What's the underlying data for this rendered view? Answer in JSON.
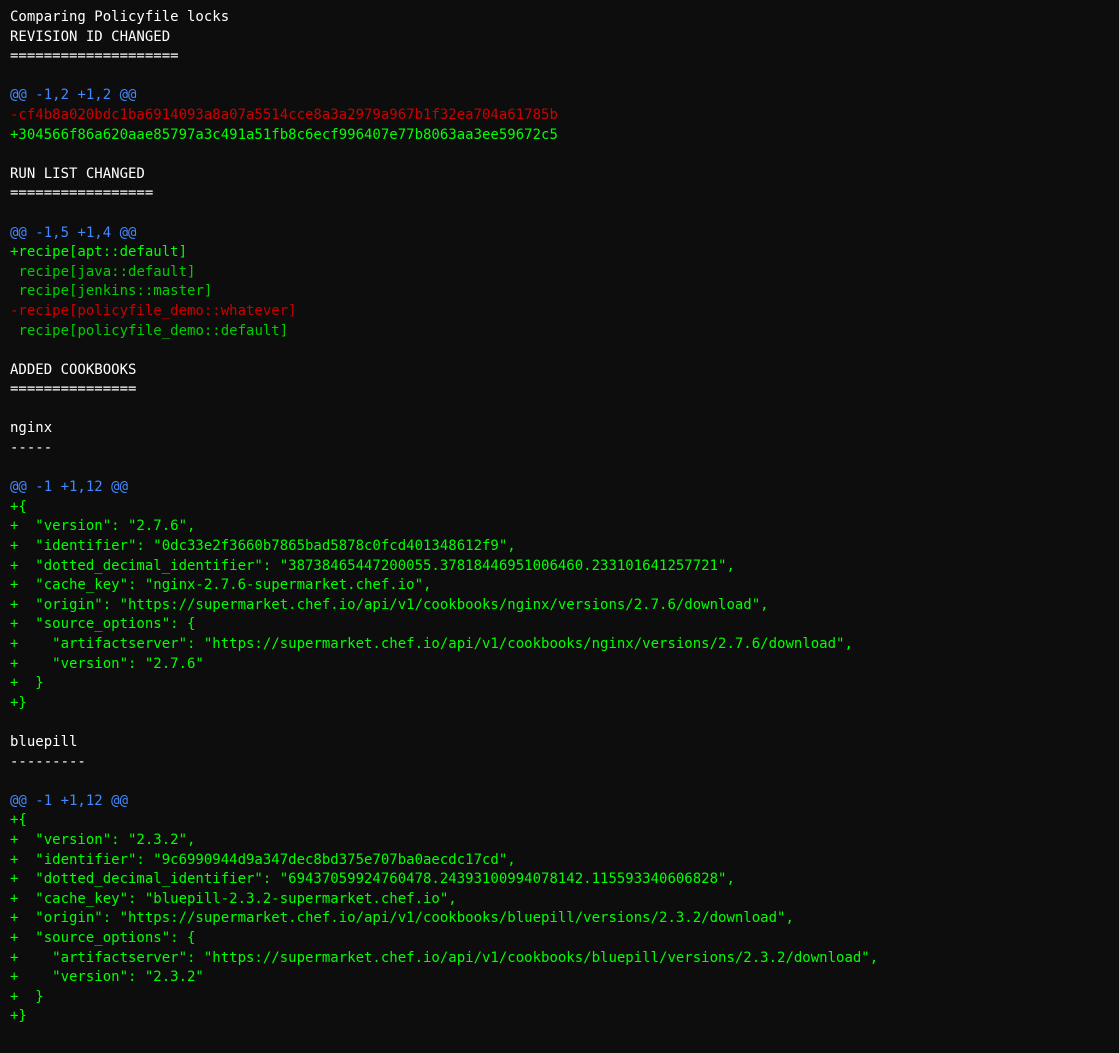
{
  "terminal": {
    "title": "Comparing Policyfile locks",
    "sections": [
      {
        "heading": "REVISION ID CHANGED",
        "separator": "====================",
        "hunk_header": "@@ -1,2 +1,2 @@",
        "lines": [
          {
            "type": "removed",
            "text": "-cf4b8a020bdc1ba6914093a8a07a5514cce8a3a2979a967b1f32ea704a61785b"
          },
          {
            "type": "added",
            "text": "+304566f86a620aae85797a3c491a51fb8c6ecf996407e77b8063aa3ee59672c5"
          }
        ]
      },
      {
        "heading": "RUN LIST CHANGED",
        "separator": "=================",
        "hunk_header": "@@ -1,5 +1,4 @@",
        "lines": [
          {
            "type": "added",
            "text": "+recipe[apt::default]"
          },
          {
            "type": "context",
            "text": " recipe[java::default]"
          },
          {
            "type": "context",
            "text": " recipe[jenkins::master]"
          },
          {
            "type": "removed",
            "text": "-recipe[policyfile_demo::whatever]"
          },
          {
            "type": "context",
            "text": " recipe[policyfile_demo::default]"
          }
        ]
      },
      {
        "heading": "ADDED COOKBOOKS",
        "separator": "===============",
        "cookbooks": [
          {
            "name": "nginx",
            "underline": "-----",
            "hunk_header": "@@ -1 +1,12 @@",
            "lines": [
              "+{",
              "+  \"version\": \"2.7.6\",",
              "+  \"identifier\": \"0dc33e2f3660b7865bad5878c0fcd401348612f9\",",
              "+  \"dotted_decimal_identifier\": \"38738465447200055.37818446951006460.233101641257721\",",
              "+  \"cache_key\": \"nginx-2.7.6-supermarket.chef.io\",",
              "+  \"origin\": \"https://supermarket.chef.io/api/v1/cookbooks/nginx/versions/2.7.6/download\",",
              "+  \"source_options\": {",
              "+    \"artifactserver\": \"https://supermarket.chef.io/api/v1/cookbooks/nginx/versions/2.7.6/download\",",
              "+    \"version\": \"2.7.6\"",
              "+  }",
              "+}"
            ]
          },
          {
            "name": "bluepill",
            "underline": "---------",
            "hunk_header": "@@ -1 +1,12 @@",
            "lines": [
              "+{",
              "+  \"version\": \"2.3.2\",",
              "+  \"identifier\": \"9c6990944d9a347dec8bd375e707ba0aecdc17cd\",",
              "+  \"dotted_decimal_identifier\": \"69437059924760478.24393100994078142.115593340606828\",",
              "+  \"cache_key\": \"bluepill-2.3.2-supermarket.chef.io\",",
              "+  \"origin\": \"https://supermarket.chef.io/api/v1/cookbooks/bluepill/versions/2.3.2/download\",",
              "+  \"source_options\": {",
              "+    \"artifactserver\": \"https://supermarket.chef.io/api/v1/cookbooks/bluepill/versions/2.3.2/download\",",
              "+    \"version\": \"2.3.2\"",
              "+  }",
              "+}"
            ]
          }
        ]
      }
    ]
  }
}
